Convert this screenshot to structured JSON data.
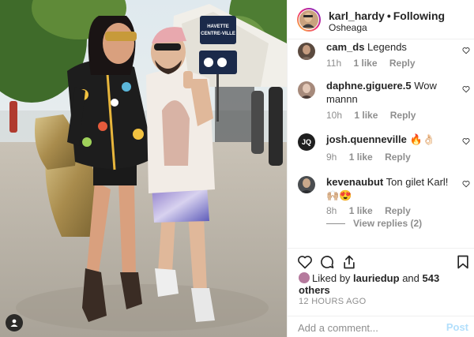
{
  "post": {
    "username": "karl_hardy",
    "separator": "•",
    "follow_state": "Following",
    "location": "Osheaga",
    "likes_prefix": "Liked by",
    "liked_by_user": "lauriedup",
    "likes_conjunction": "and",
    "likes_others": "543 others",
    "timestamp": "12 HOURS AGO"
  },
  "photo": {
    "sign_line1": "HAVETTE",
    "sign_line2": "CENTRE-VILLE"
  },
  "comments": [
    {
      "username": "cam_ds",
      "text": "Legends",
      "age": "11h",
      "likes": "1 like",
      "reply": "Reply",
      "avatar_color": "#5b4a3f"
    },
    {
      "username": "daphne.giguere.5",
      "text": "Wow mannn",
      "age": "10h",
      "likes": "1 like",
      "reply": "Reply",
      "avatar_color": "#a68a7b"
    },
    {
      "username": "josh.quenneville",
      "text": "🔥👌🏻",
      "age": "9h",
      "likes": "1 like",
      "reply": "Reply",
      "avatar_initials": "JQ",
      "avatar_color": "#1f1f1f"
    },
    {
      "username": "kevenaubut",
      "text": "Ton gilet Karl! 🙌🏼😍",
      "age": "8h",
      "likes": "1 like",
      "reply": "Reply",
      "avatar_color": "#4a4d50"
    }
  ],
  "view_replies": "View replies (2)",
  "comment_box": {
    "placeholder": "Add a comment...",
    "post_label": "Post"
  },
  "icons": {
    "heart": "heart-icon",
    "comment": "comment-icon",
    "share": "share-icon",
    "bookmark": "bookmark-icon",
    "user_tag": "user-tag-icon"
  },
  "colors": {
    "text": "#262626",
    "muted": "#8e8e8e",
    "post_disabled": "#b2dffc",
    "border": "#efefef"
  }
}
